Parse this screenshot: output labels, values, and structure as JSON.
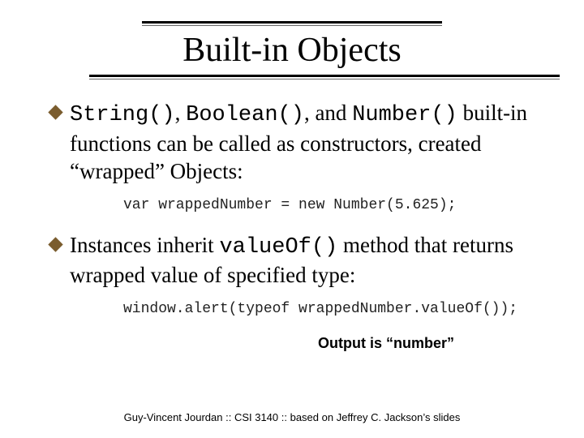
{
  "title": "Built-in Objects",
  "bullets": [
    {
      "seg1": "String()",
      "seg2": ", ",
      "seg3": "Boolean()",
      "seg4": ", and ",
      "seg5": "Number()",
      "tail": " built-in functions can be called as constructors, created “wrapped” Objects:"
    },
    {
      "lead": "Instances inherit ",
      "code": "valueOf()",
      "tail": " method that returns wrapped value of specified type:"
    }
  ],
  "code_lines": {
    "line1": "var wrappedNumber = new Number(5.625);",
    "line2": "window.alert(typeof wrappedNumber.valueOf());"
  },
  "output_note": "Output is “number”",
  "footer": "Guy-Vincent Jourdan :: CSI 3140 :: based on Jeffrey C. Jackson’s slides"
}
